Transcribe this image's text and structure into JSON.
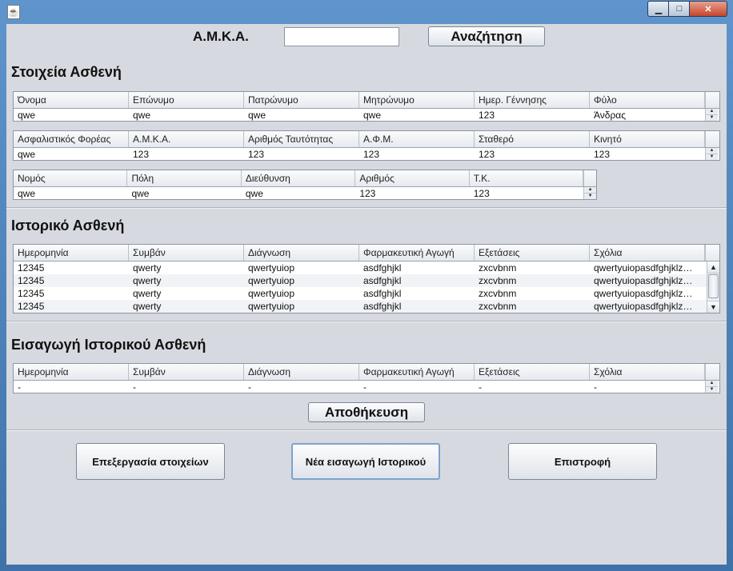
{
  "window": {
    "title": "",
    "controls": {
      "minimize": "▁",
      "maximize": "□",
      "close": "✕"
    }
  },
  "search": {
    "label": "Α.Μ.Κ.Α.",
    "value": "",
    "button": "Αναζήτηση"
  },
  "patient_info": {
    "title": "Στοιχεία Ασθενή",
    "table1": {
      "headers": [
        "Όνομα",
        "Επώνυμο",
        "Πατρώνυμο",
        "Μητρώνυμο",
        "Ημερ. Γέννησης",
        "Φύλο"
      ],
      "row": [
        "qwe",
        "qwe",
        "qwe",
        "qwe",
        "123",
        "Άνδρας"
      ]
    },
    "table2": {
      "headers": [
        "Ασφαλιστικός Φορέας",
        "Α.Μ.Κ.Α.",
        "Αριθμός Ταυτότητας",
        "Α.Φ.Μ.",
        "Σταθερό",
        "Κινητό"
      ],
      "row": [
        "qwe",
        "123",
        "123",
        "123",
        "123",
        "123"
      ]
    },
    "table3": {
      "headers": [
        "Νομός",
        "Πόλη",
        "Διεύθυνση",
        "Αριθμός",
        "Τ.Κ."
      ],
      "row": [
        "qwe",
        "qwe",
        "qwe",
        "123",
        "123"
      ]
    }
  },
  "history": {
    "title": "Ιστορικό Ασθενή",
    "headers": [
      "Ημερομηνία",
      "Συμβάν",
      "Διάγνωση",
      "Φαρμακευτική Αγωγή",
      "Εξετάσεις",
      "Σχόλια"
    ],
    "rows": [
      [
        "12345",
        "qwerty",
        "qwertyuiop",
        "asdfghjkl",
        "zxcvbnm",
        "qwertyuiopasdfghjklzxcvbnm"
      ],
      [
        "12345",
        "qwerty",
        "qwertyuiop",
        "asdfghjkl",
        "zxcvbnm",
        "qwertyuiopasdfghjklzxcvbnm"
      ],
      [
        "12345",
        "qwerty",
        "qwertyuiop",
        "asdfghjkl",
        "zxcvbnm",
        "qwertyuiopasdfghjklzxcvbnm"
      ],
      [
        "12345",
        "qwerty",
        "qwertyuiop",
        "asdfghjkl",
        "zxcvbnm",
        "qwertyuiopasdfghjklzxcvbnm"
      ]
    ]
  },
  "new_history": {
    "title": "Εισαγωγή Ιστορικού Ασθενή",
    "headers": [
      "Ημερομηνία",
      "Συμβάν",
      "Διάγνωση",
      "Φαρμακευτική Αγωγή",
      "Εξετάσεις",
      "Σχόλια"
    ],
    "row": [
      "-",
      "-",
      "-",
      "-",
      "-",
      "-"
    ],
    "save_button": "Αποθήκευση"
  },
  "actions": {
    "edit": "Επεξεργασία στοιχείων",
    "new_entry": "Νέα εισαγωγή Ιστορικού",
    "back": "Επιστροφή"
  }
}
